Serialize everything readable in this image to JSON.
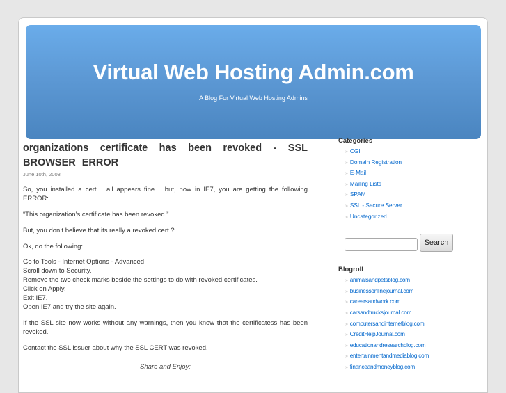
{
  "header": {
    "title": "Virtual Web Hosting Admin.com",
    "description": "A Blog For Virtual Web Hosting Admins",
    "gradient_colors": [
      "#6aacea",
      "#4a85c0"
    ]
  },
  "post": {
    "title": "organizations certificate has been revoked - SSL BROWSER ERROR",
    "date": "June 10th, 2008",
    "paragraphs": {
      "intro": "So, you installed a cert… all appears fine… but, now in IE7, you are getting the following ERROR:",
      "quote": "“This organization’s certificate has been revoked.”",
      "doubt": "But, you don’t believe that its really a revoked cert ?",
      "lead": "Ok, do the following:",
      "steps": [
        "Go to Tools - Internet Options - Advanced.",
        "Scroll down to Security.",
        "Remove the two check marks beside the settings to do with revoked certificates.",
        "Click on Apply.",
        "Exit IE7.",
        "Open IE7 and try the site again."
      ],
      "result": "If the SSL site now works without any warnings, then you know that the certificatess has been revoked.",
      "contact": "Contact the SSL issuer about why the SSL CERT was revoked.",
      "share": "Share and Enjoy:"
    }
  },
  "sidebar": {
    "categories": {
      "title": "Categories",
      "bullet": "»",
      "items": [
        "CGI",
        "Domain Registration",
        "E-Mail",
        "Mailing Lists",
        "SPAM",
        "SSL - Secure Server",
        "Uncategorized"
      ]
    },
    "search": {
      "input_value": "",
      "button_label": "Search"
    },
    "blogroll": {
      "title": "Blogroll",
      "bullet": "»",
      "items": [
        "animalsandpetsblog.com",
        "businessonlinejournal.com",
        "careersandwork.com",
        "carsandtrucksjournal.com",
        "computersandinternetblog.com",
        "CreditHelpJournal.com",
        "educationandresearchblog.com",
        "entertainmentandmediablog.com",
        "financeandmoneyblog.com"
      ]
    }
  },
  "colors": {
    "link": "#0066cc",
    "text": "#333333",
    "background": "#e7e7e7"
  }
}
